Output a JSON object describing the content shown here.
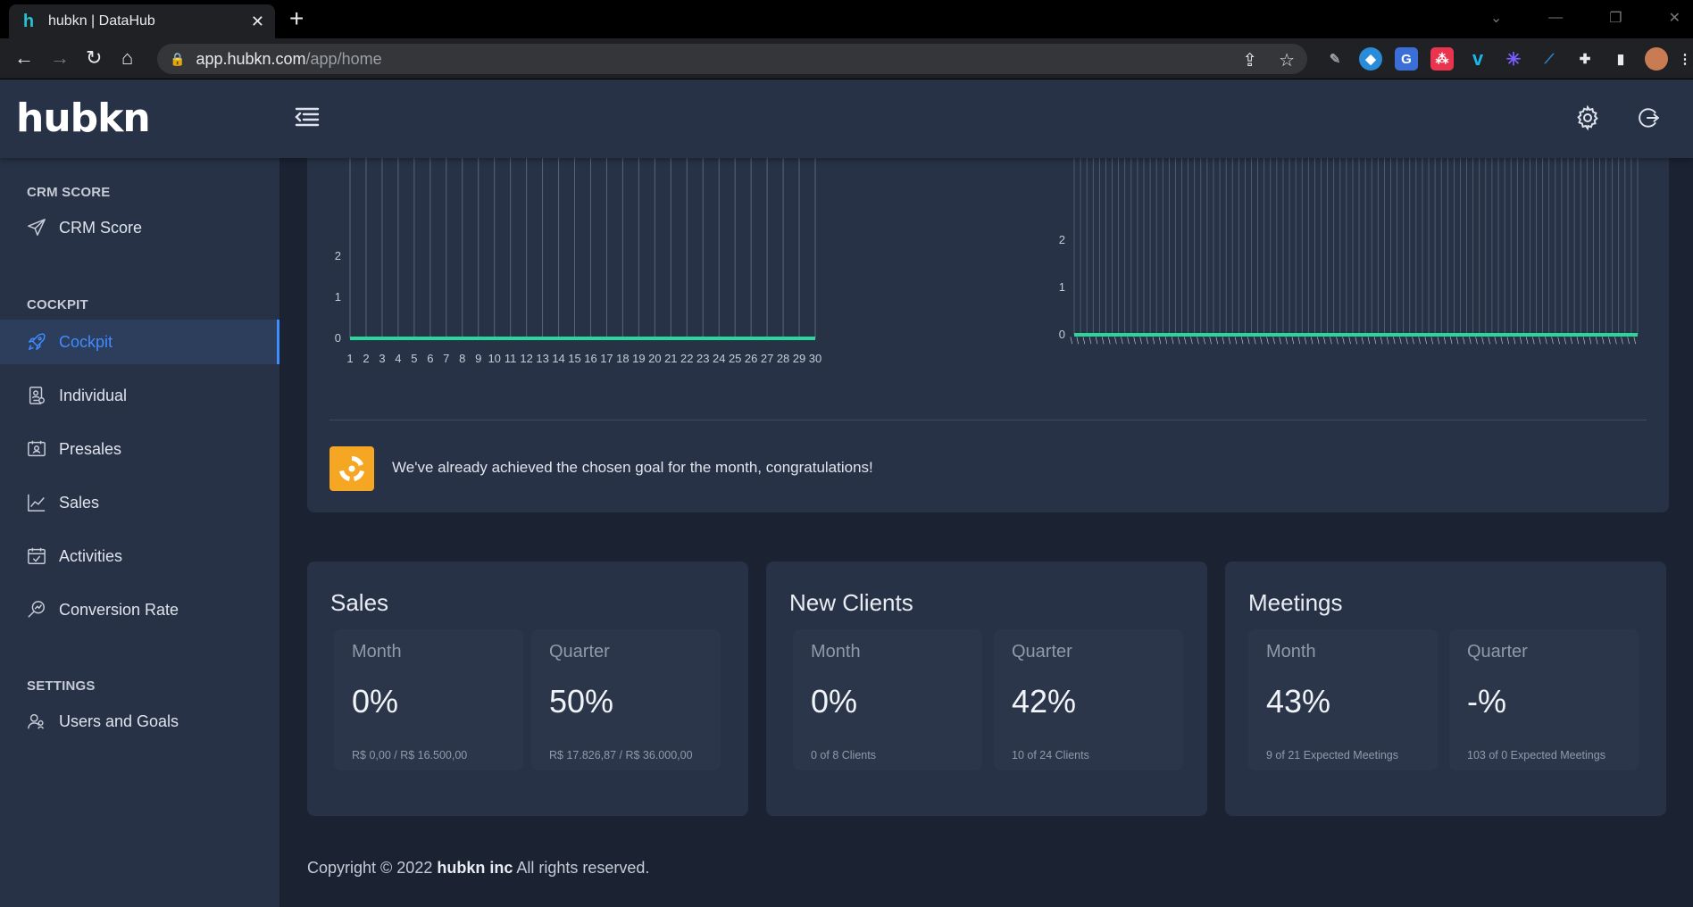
{
  "browser": {
    "tab_title": "hubkn | DataHub",
    "url_host": "app.hubkn.com",
    "url_path": "/app/home"
  },
  "app": {
    "logo": "hubkn"
  },
  "sidebar": {
    "sections": [
      {
        "title": "CRM SCORE",
        "items": [
          {
            "label": "CRM Score",
            "icon": "send-icon"
          }
        ]
      },
      {
        "title": "COCKPIT",
        "items": [
          {
            "label": "Cockpit",
            "icon": "rocket-icon",
            "active": true
          },
          {
            "label": "Individual",
            "icon": "id-badge-icon"
          },
          {
            "label": "Presales",
            "icon": "contact-card-icon"
          },
          {
            "label": "Sales",
            "icon": "line-chart-icon"
          },
          {
            "label": "Activities",
            "icon": "calendar-check-icon"
          },
          {
            "label": "Conversion Rate",
            "icon": "search-chart-icon"
          }
        ]
      },
      {
        "title": "SETTINGS",
        "items": [
          {
            "label": "Users and Goals",
            "icon": "users-icon"
          }
        ]
      }
    ]
  },
  "chart_data": [
    {
      "type": "line",
      "x": [
        1,
        2,
        3,
        4,
        5,
        6,
        7,
        8,
        9,
        10,
        11,
        12,
        13,
        14,
        15,
        16,
        17,
        18,
        19,
        20,
        21,
        22,
        23,
        24,
        25,
        26,
        27,
        28,
        29,
        30
      ],
      "y": [
        0,
        0,
        0,
        0,
        0,
        0,
        0,
        0,
        0,
        0,
        0,
        0,
        0,
        0,
        0,
        0,
        0,
        0,
        0,
        0,
        0,
        0,
        0,
        0,
        0,
        0,
        0,
        0,
        0,
        0
      ],
      "yticks": [
        0,
        1,
        2
      ],
      "color": "#2bd69a"
    },
    {
      "type": "line",
      "points": 90,
      "y_constant": 0,
      "yticks": [
        0,
        1,
        2
      ],
      "color": "#2bd69a"
    }
  ],
  "goal": {
    "message": "We've already achieved the chosen goal for the month, congratulations!"
  },
  "kpis": [
    {
      "title": "Sales",
      "month": {
        "label": "Month",
        "value": "0%",
        "detail": "R$ 0,00 / R$ 16.500,00"
      },
      "quarter": {
        "label": "Quarter",
        "value": "50%",
        "detail": "R$ 17.826,87 / R$ 36.000,00"
      }
    },
    {
      "title": "New Clients",
      "month": {
        "label": "Month",
        "value": "0%",
        "detail": "0 of 8 Clients"
      },
      "quarter": {
        "label": "Quarter",
        "value": "42%",
        "detail": "10 of 24 Clients"
      }
    },
    {
      "title": "Meetings",
      "month": {
        "label": "Month",
        "value": "43%",
        "detail": "9 of 21 Expected Meetings"
      },
      "quarter": {
        "label": "Quarter",
        "value": "-%",
        "detail": "103 of 0 Expected Meetings"
      }
    }
  ],
  "footer": {
    "prefix": "Copyright © 2022 ",
    "company": "hubkn inc",
    "suffix": " All rights reserved."
  }
}
